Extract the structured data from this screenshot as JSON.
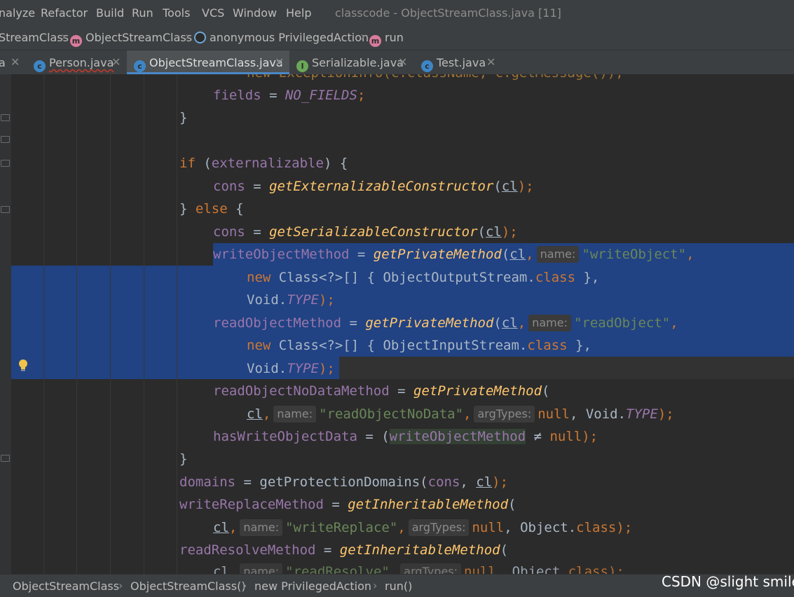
{
  "menu": {
    "items": [
      "nalyze",
      "Refactor",
      "Build",
      "Run",
      "Tools",
      "VCS",
      "Window",
      "Help"
    ],
    "window_title": "classcode - ObjectStreamClass.java [11]"
  },
  "navbar": {
    "items": [
      "StreamClass",
      "ObjectStreamClass",
      "anonymous PrivilegedAction",
      "run"
    ]
  },
  "tabs": [
    {
      "label": "a",
      "active": false
    },
    {
      "label": "Person.java",
      "active": false
    },
    {
      "label": "ObjectStreamClass.java",
      "active": true
    },
    {
      "label": "Serializable.java",
      "active": false
    },
    {
      "label": "Test.java",
      "active": false
    }
  ],
  "code": {
    "l0": {
      "t1": "new ExceptionInfo(c.className, c.getMessage());"
    },
    "l1": {
      "t1": "fields",
      "t2": " = ",
      "t3": "NO_FIELDS",
      "t4": ";"
    },
    "l2": {
      "t1": "}"
    },
    "l4": {
      "t1": "if",
      "t2": " (",
      "t3": "externalizable",
      "t4": ") {"
    },
    "l5": {
      "t1": "cons",
      "t2": " = ",
      "t3": "getExternalizableConstructor",
      "t4": "(",
      "t5": "cl",
      "t6": ");"
    },
    "l6": {
      "t1": "} ",
      "t2": "else",
      "t3": " {"
    },
    "l7": {
      "t1": "cons",
      "t2": " = ",
      "t3": "getSerializableConstructor",
      "t4": "(",
      "t5": "cl",
      "t6": ");"
    },
    "l8": {
      "t1": "writeObjectMethod",
      "t2": " = ",
      "t3": "getPrivateMethod",
      "t4": "(",
      "t5": "cl",
      "t6": ",",
      "h1": "name:",
      "t7": "\"writeObject\"",
      "t8": ","
    },
    "l9": {
      "t1": "new",
      "t2": " Class<?>[] { ObjectOutputStream.",
      "t3": "class",
      "t4": " },"
    },
    "l10": {
      "t1": "Void.",
      "t2": "TYPE",
      "t3": ");"
    },
    "l11": {
      "t1": "readObjectMethod",
      "t2": " = ",
      "t3": "getPrivateMethod",
      "t4": "(",
      "t5": "cl",
      "t6": ",",
      "h1": "name:",
      "t7": "\"readObject\"",
      "t8": ","
    },
    "l12": {
      "t1": "new",
      "t2": " Class<?>[] { ObjectInputStream.",
      "t3": "class",
      "t4": " },"
    },
    "l13": {
      "t1": "Void.",
      "t2": "TYPE",
      "t3": ");"
    },
    "l14": {
      "t1": "readObjectNoDataMethod",
      "t2": " = ",
      "t3": "getPrivateMethod",
      "t4": "("
    },
    "l15": {
      "t1": "cl",
      "t2": ",",
      "h1": "name:",
      "t3": "\"readObjectNoData\"",
      "t4": ",",
      "h2": "argTypes:",
      "t5": "null",
      "t6": ", Void.",
      "t7": "TYPE",
      "t8": ");"
    },
    "l16": {
      "t1": "hasWriteObjectData",
      "t2": " = (",
      "t3": "writeObjectMethod",
      "t4": " ≠ ",
      "t5": "null",
      "t6": ");"
    },
    "l17": {
      "t1": "}"
    },
    "l18": {
      "t1": "domains",
      "t2": " = getProtectionDomains(",
      "t3": "cons",
      "t4": ", ",
      "t5": "cl",
      "t6": ");"
    },
    "l19": {
      "t1": "writeReplaceMethod",
      "t2": " = ",
      "t3": "getInheritableMethod",
      "t4": "("
    },
    "l20": {
      "t1": "cl",
      "t2": ",",
      "h1": "name:",
      "t3": "\"writeReplace\"",
      "t4": ",",
      "h2": "argTypes:",
      "t5": "null",
      "t6": ", Object.",
      "t7": "class",
      "t8": ");"
    },
    "l21": {
      "t1": "readResolveMethod",
      "t2": " = ",
      "t3": "getInheritableMethod",
      "t4": "("
    },
    "l22": {
      "t1": "cl",
      "t2": ",",
      "h1": "name:",
      "t3": "\"readResolve\"",
      "t4": ",",
      "h2": "argTypes:",
      "t5": "null",
      "t6": ", Object.",
      "t7": "class",
      "t8": ");"
    }
  },
  "status": {
    "crumbs": [
      "ObjectStreamClass",
      "ObjectStreamClass()",
      "new PrivilegedAction",
      "run()"
    ]
  },
  "watermark": "CSDN @slight smile",
  "colors": {
    "background": "#2b2b2b",
    "selection": "#214283",
    "keyword": "#cc7832",
    "field": "#9876aa",
    "method": "#ffc66d",
    "string": "#6a8759",
    "tab_underline": "#4a88c7"
  },
  "icons": {
    "class_icon": "c-circle-blue",
    "method_icon": "m-circle-pink",
    "interface_icon": "i-circle-green",
    "lambda_icon": "anonymous-class-circle",
    "intention_bulb": "lightbulb-icon"
  }
}
